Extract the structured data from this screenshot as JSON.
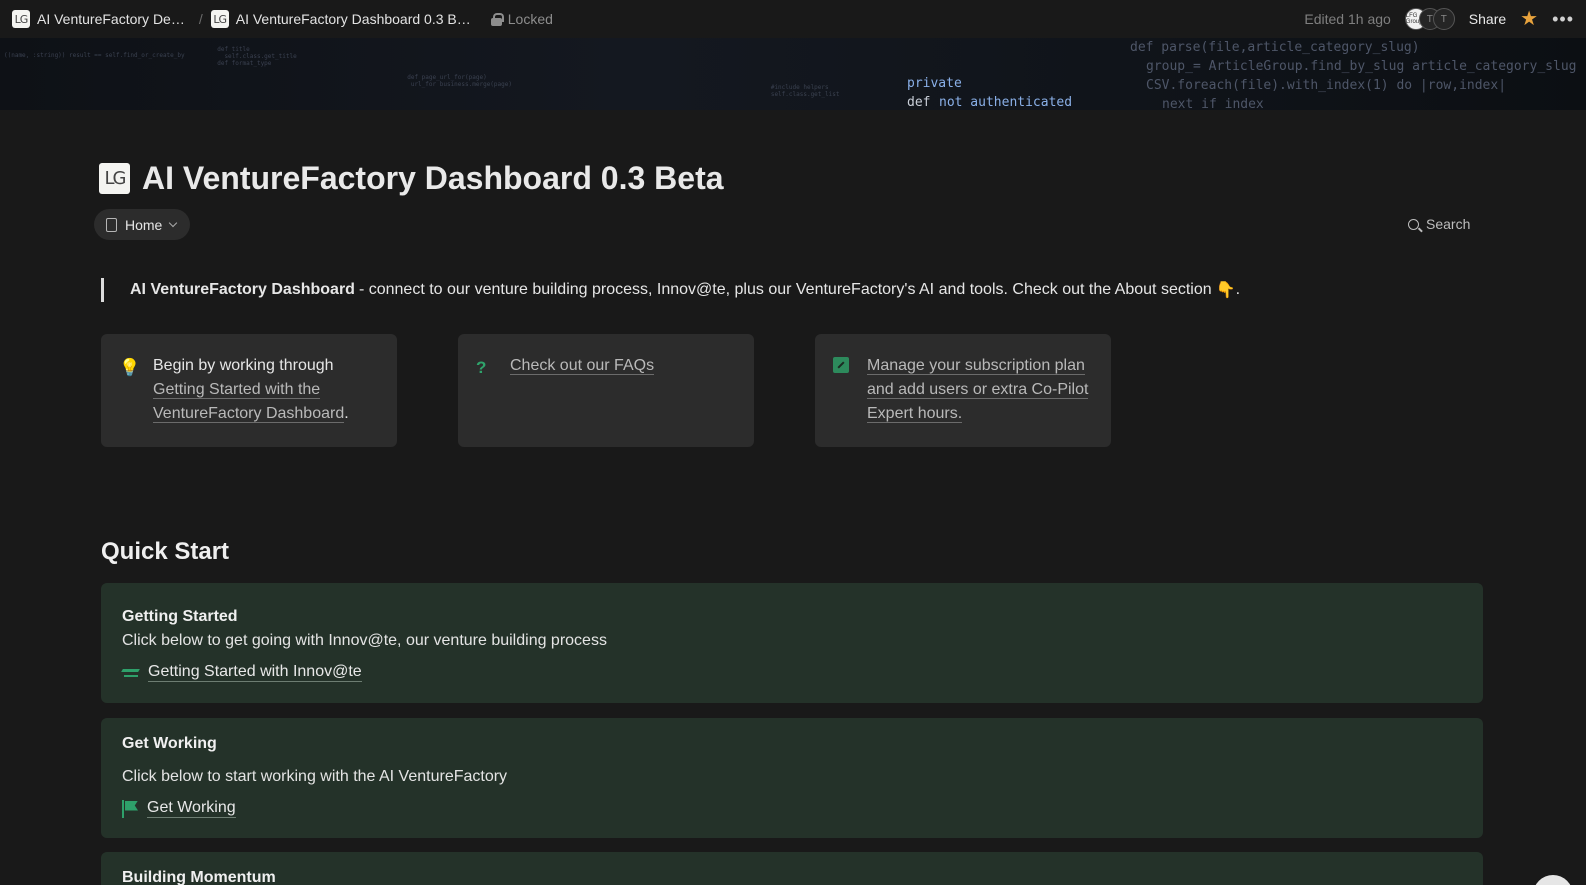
{
  "topbar": {
    "crumbs": [
      {
        "icon": "LG",
        "label": "AI VentureFactory De…"
      },
      {
        "icon": "LG",
        "label": "AI VentureFactory Dashboard 0.3 B…"
      }
    ],
    "separator": "/",
    "locked_label": "Locked",
    "edited_label": "Edited 1h ago",
    "avatars": [
      "LFG Group",
      "T",
      "T"
    ],
    "share_label": "Share"
  },
  "banner": {
    "code_bright": "private",
    "code_keyword": "def",
    "code_auth": "not authenticated",
    "code_line1": "def parse(file,article_category_slug)",
    "code_line2": "group_= ArticleGroup.find_by_slug article_category_slug",
    "code_line3": "CSV.foreach(file).with_index(1) do |row,index|",
    "code_line4": "next if index"
  },
  "page": {
    "icon": "LG",
    "title": "AI VentureFactory Dashboard 0.3 Beta",
    "home_label": "Home",
    "search_label": "Search"
  },
  "intro": {
    "bold": "AI VentureFactory Dashboard",
    "text": "- connect to our venture building process, Innov@te, plus our VentureFactory's AI and tools. Check out the About section",
    "emoji": "👇",
    "trail": "."
  },
  "callouts": [
    {
      "icon": "lightbulb-icon",
      "prefix": "Begin by working through",
      "link": "Getting Started with the VentureFactory Dashboard",
      "suffix": "."
    },
    {
      "icon": "question-icon",
      "prefix": "",
      "link": "Check out our FAQs",
      "suffix": ""
    },
    {
      "icon": "arrow-up-right-icon",
      "prefix": "",
      "link": "Manage your subscription plan and add users or extra Co-Pilot Expert hours.",
      "suffix": ""
    }
  ],
  "quick_start": {
    "heading": "Quick Start",
    "cards": [
      {
        "title": "Getting Started",
        "desc": "Click below to get going with Innov@te, our venture building process",
        "link": "Getting Started with Innov@te",
        "icon": "plane-icon"
      },
      {
        "title": "Get Working",
        "desc": "Click below to start working with the AI VentureFactory",
        "link": "Get Working",
        "icon": "flag-icon"
      },
      {
        "title": "Building Momentum"
      }
    ]
  },
  "colors": {
    "background": "#191919",
    "card_green": "#243229",
    "accent_green": "#2ea06a",
    "star": "#e8a33d"
  }
}
